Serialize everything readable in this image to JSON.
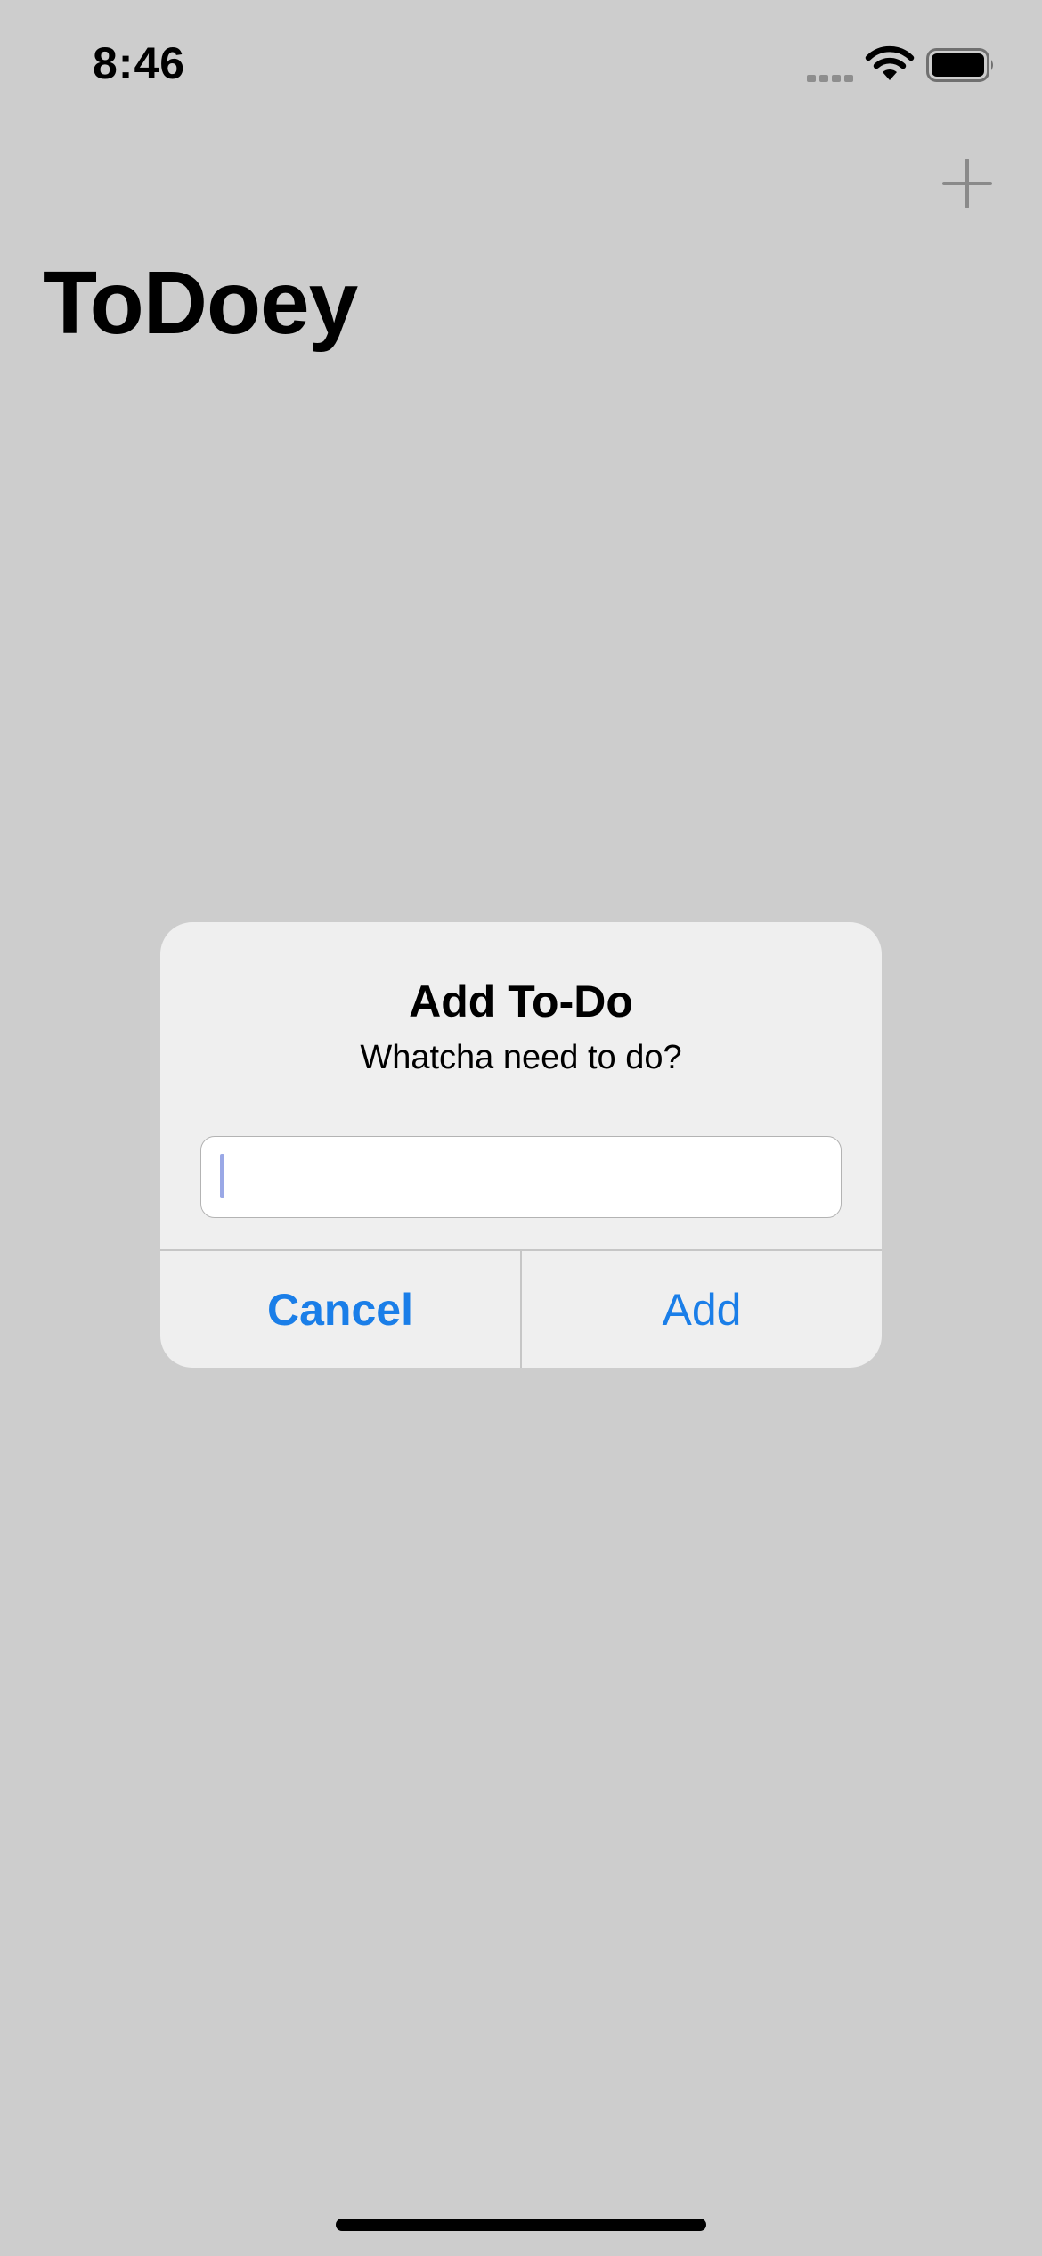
{
  "status_bar": {
    "time": "8:46"
  },
  "nav": {
    "add_icon": "plus-icon",
    "title": "ToDoey"
  },
  "alert": {
    "title": "Add To-Do",
    "message": "Whatcha need to do?",
    "input_value": "",
    "input_placeholder": "",
    "cancel_label": "Cancel",
    "add_label": "Add"
  },
  "colors": {
    "background": "#cdcdcd",
    "alert_background": "#efefef",
    "accent": "#1a7ee8"
  }
}
